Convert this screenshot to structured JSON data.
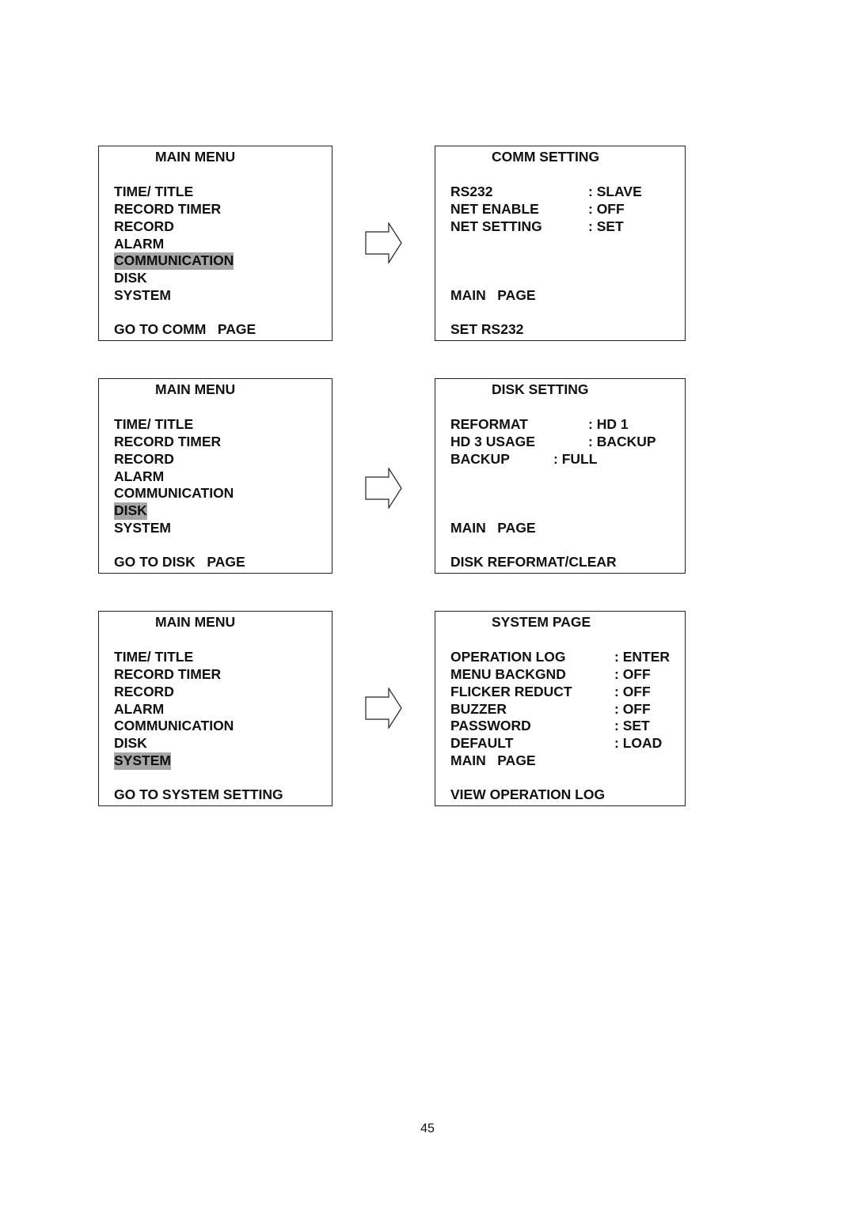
{
  "panels": [
    {
      "main_menu": {
        "title": "MAIN MENU",
        "items": [
          "TIME/ TITLE",
          "RECORD TIMER",
          "RECORD",
          "ALARM",
          "COMMUNICATION",
          "DISK",
          "SYSTEM"
        ],
        "selected": "COMMUNICATION",
        "hint": "GO TO COMM   PAGE"
      },
      "submenu": {
        "title": "COMM SETTING",
        "settings": [
          {
            "label": "RS232",
            "value": ": SLAVE"
          },
          {
            "label": "NET ENABLE",
            "value": ": OFF"
          },
          {
            "label": "NET SETTING",
            "value": ": SET"
          }
        ],
        "main_page": "MAIN   PAGE",
        "hint": "SET RS232"
      }
    },
    {
      "main_menu": {
        "title": "MAIN MENU",
        "items": [
          "TIME/ TITLE",
          "RECORD TIMER",
          "RECORD",
          "ALARM",
          "COMMUNICATION",
          "DISK",
          "SYSTEM"
        ],
        "selected": "DISK",
        "hint": "GO TO DISK   PAGE"
      },
      "submenu": {
        "title": "DISK SETTING",
        "settings": [
          {
            "label": "REFORMAT",
            "value": ": HD 1"
          },
          {
            "label": "HD 3 USAGE",
            "value": ": BACKUP"
          },
          {
            "label": "BACKUP",
            "value": ": FULL"
          }
        ],
        "main_page": "MAIN   PAGE",
        "hint": "DISK REFORMAT/CLEAR"
      }
    },
    {
      "main_menu": {
        "title": "MAIN MENU",
        "items": [
          "TIME/ TITLE",
          "RECORD TIMER",
          "RECORD",
          "ALARM",
          "COMMUNICATION",
          "DISK",
          "SYSTEM"
        ],
        "selected": "SYSTEM",
        "hint": "GO TO SYSTEM SETTING"
      },
      "submenu": {
        "title": "SYSTEM PAGE",
        "settings": [
          {
            "label": "OPERATION LOG",
            "value": ": ENTER"
          },
          {
            "label": "MENU BACKGND",
            "value": ": OFF"
          },
          {
            "label": "FLICKER REDUCT",
            "value": ": OFF"
          },
          {
            "label": "BUZZER",
            "value": ": OFF"
          },
          {
            "label": "PASSWORD",
            "value": ": SET"
          },
          {
            "label": "DEFAULT",
            "value": ": LOAD"
          }
        ],
        "main_page": "MAIN   PAGE",
        "hint": "VIEW OPERATION LOG"
      }
    }
  ],
  "arrow_icon": "right-arrow-icon",
  "highlight_color": "#a6a6a6",
  "page_number": "45"
}
